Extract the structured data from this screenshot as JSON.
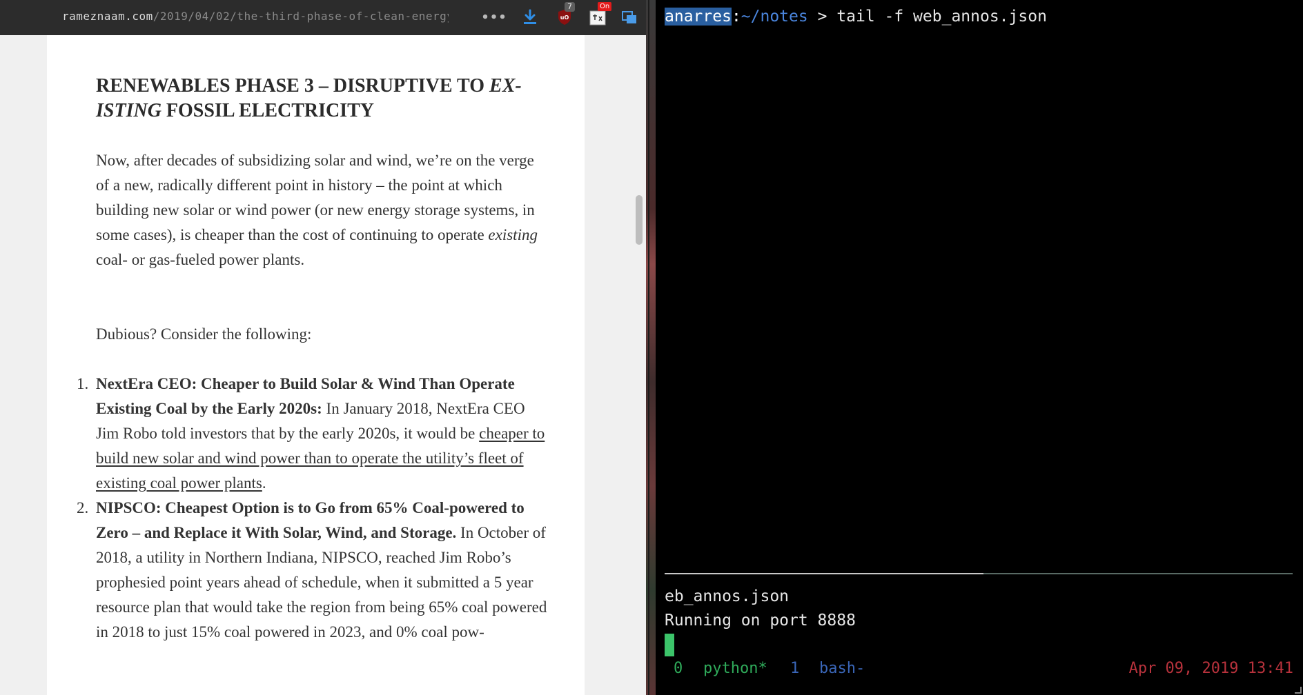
{
  "browser": {
    "url_host": "rameznaam.com",
    "url_path": "/2019/04/02/the-third-phase-of-clean-energy",
    "more_label": "•••",
    "ublock_badge": "7",
    "translate_badge": "On",
    "article": {
      "heading_part1": "RENEWABLES PHASE 3 – DISRUPTIVE TO ",
      "heading_emph": "EX­ISTING",
      "heading_part2": " FOSSIL ELECTRICITY",
      "para1_before": "Now, after decades of subsidizing solar and wind, we’re on the verge of a new, radically different point in history – the point at which building new solar or wind power (or new energy storage systems, in some cases), is cheaper than the cost of continuing to operate ",
      "para1_emph": "existing",
      "para1_after": " coal- or gas-fueled power plants.",
      "para2": "Dubious?  Consider the following:",
      "items": [
        {
          "number": "1.",
          "bold": "NextEra CEO:  Cheaper to Build Solar & Wind Than Op­erate Existing Coal by the Early 2020s:",
          "text_before_link": " In January 2018, NextEra CEO Jim Robo told investors that by the early 2020s, it would be ",
          "link": "cheaper to build new solar and wind power than to operate the utility’s fleet of existing coal power plants",
          "text_after_link": "."
        },
        {
          "number": "2.",
          "bold": "NIPSCO: Cheapest Option is to Go from 65% Coal-powered to Zero – and Replace it With Solar, Wind, and Storage.",
          "text": "  In October of 2018, a utility in Northern Indiana, NIPSCO, reached Jim Robo’s prophesied point years ahead of schedule, when it submitted a 5 year resource plan that would take the region from being 65% coal powered in 2018 to just 15% coal powered in 2023, and 0% coal pow-"
        }
      ]
    }
  },
  "terminal": {
    "prompt_host": "anarres",
    "prompt_colon": ":",
    "prompt_path": "~/notes",
    "prompt_sep": " > ",
    "command": "tail -f web_annos.json",
    "output_line1": "eb_annos.json",
    "output_line2": "Running on port 8888",
    "status": {
      "windows": [
        {
          "index": "0",
          "name": "python*"
        },
        {
          "index": "1",
          "name": "bash-"
        }
      ],
      "datetime": "Apr 09, 2019 13:41"
    }
  },
  "colors": {
    "prompt_host_bg": "#2a5fa0",
    "prompt_path": "#4a85dd",
    "active_window": "#2faa5a",
    "inactive_window": "#3a66b8",
    "datetime": "#b8323c",
    "cursor": "#3cc46a"
  },
  "icons": [
    "more-icon",
    "download-icon",
    "ublock-icon",
    "translate-icon",
    "windows-icon"
  ]
}
